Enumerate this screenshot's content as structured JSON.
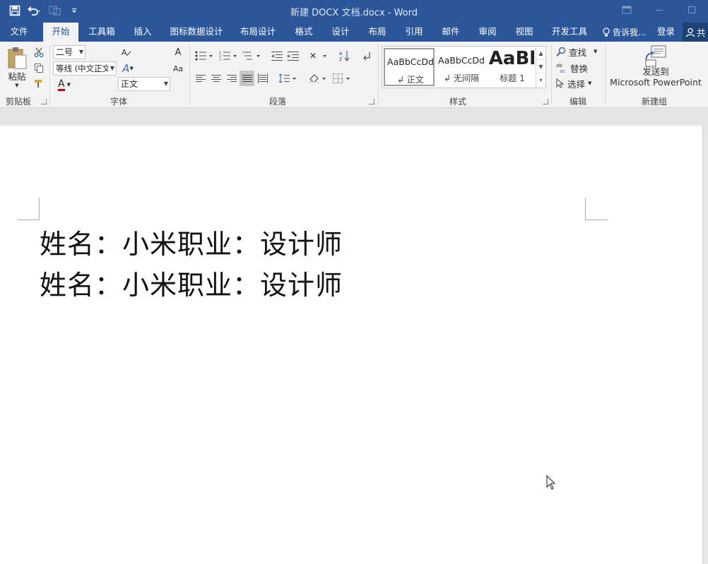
{
  "window": {
    "title": "新建 DOCX 文档.docx - Word"
  },
  "tabs": {
    "file": "文件",
    "home": "开始",
    "toolbox": "工具箱",
    "insert": "插入",
    "chart_design": "图标数据设计",
    "layout_design": "布局设计",
    "format": "格式",
    "design": "设计",
    "layout": "布局",
    "references": "引用",
    "mailings": "邮件",
    "review": "审阅",
    "view": "视图",
    "developer": "开发工具",
    "tell_me": "告诉我...",
    "sign_in": "登录",
    "share": "共"
  },
  "ribbon": {
    "clipboard": {
      "paste_label": "粘贴",
      "group_label": "剪贴板"
    },
    "font": {
      "size_value": "二号",
      "font_name_value": "等线 (中文正文",
      "style_value": "正文",
      "group_label": "字体",
      "grow_glyph": "A",
      "case_glyph": "Aa",
      "color_glyph": "A",
      "effects_glyph": "A",
      "clear_glyph": "A"
    },
    "paragraph": {
      "group_label": "段落"
    },
    "styles": {
      "group_label": "样式",
      "items": [
        {
          "sample": "AaBbCcDd",
          "name": "↲ 正文"
        },
        {
          "sample": "AaBbCcDd",
          "name": "↲ 无间隔"
        },
        {
          "sample": "AaBl",
          "name": "标题 1"
        }
      ]
    },
    "editing": {
      "group_label": "编辑",
      "find": "查找",
      "replace": "替换",
      "select": "选择"
    },
    "newgroup": {
      "group_label": "新建组",
      "send_line1": "发送到",
      "send_line2": "Microsoft PowerPoint"
    }
  },
  "document": {
    "lines": [
      "姓名：小米职业：设计师",
      "姓名：小米职业：设计师"
    ]
  },
  "colors": {
    "brand": "#2b579a",
    "font_color_underline": "#c00000"
  }
}
